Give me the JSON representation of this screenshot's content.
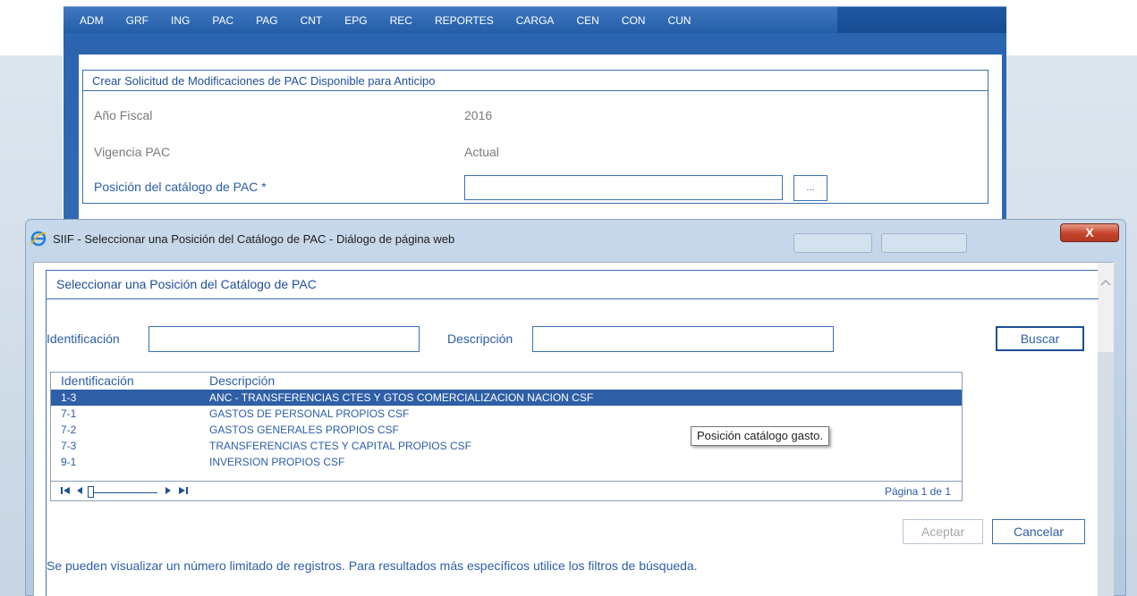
{
  "menu": [
    "ADM",
    "GRF",
    "ING",
    "PAC",
    "PAG",
    "CNT",
    "EPG",
    "REC",
    "REPORTES",
    "CARGA",
    "CEN",
    "CON",
    "CUN"
  ],
  "form": {
    "title": "Crear Solicitud de Modificaciones de PAC Disponible para Anticipo",
    "fiscal_year_label": "Año Fiscal",
    "fiscal_year_value": "2016",
    "vigencia_label": "Vigencia PAC",
    "vigencia_value": "Actual",
    "position_label": "Posición del catálogo de PAC *",
    "position_value": "",
    "ellipsis_label": "..."
  },
  "dialog": {
    "title": "SIIF - Seleccionar una Posición del Catálogo de PAC - Diálogo de página web",
    "close_label": "X",
    "panel_title": "Seleccionar una Posición del Catálogo de PAC",
    "id_label": "Identificación",
    "id_value": "",
    "desc_label": "Descripción",
    "desc_value": "",
    "search_button": "Buscar",
    "columns": [
      "Identificación",
      "Descripción"
    ],
    "rows": [
      {
        "id": "1-3",
        "desc": "ANC - TRANSFERENCIAS CTES Y GTOS COMERCIALIZACION NACION CSF",
        "selected": true
      },
      {
        "id": "7-1",
        "desc": "GASTOS DE PERSONAL PROPIOS CSF",
        "selected": false
      },
      {
        "id": "7-2",
        "desc": "GASTOS GENERALES PROPIOS CSF",
        "selected": false
      },
      {
        "id": "7-3",
        "desc": "TRANSFERENCIAS CTES Y CAPITAL PROPIOS CSF",
        "selected": false
      },
      {
        "id": "9-1",
        "desc": "INVERSION PROPIOS CSF",
        "selected": false
      }
    ],
    "tooltip": "Posición catálogo gasto.",
    "pager": {
      "page_info": "Página 1 de 1"
    },
    "accept_button": "Aceptar",
    "cancel_button": "Cancelar",
    "note": "Se pueden visualizar un número limitado de registros. Para resultados más específicos utilice los filtros de búsqueda."
  },
  "colors": {
    "accent": "#2c5da8",
    "selection": "#2f5fa6",
    "menu_bar": "#2f68b3",
    "close_button": "#c5432a"
  },
  "icons": [
    "ie-icon",
    "close-icon",
    "first-page-icon",
    "prev-page-icon",
    "next-page-icon",
    "last-page-icon",
    "scroll-up-icon"
  ]
}
